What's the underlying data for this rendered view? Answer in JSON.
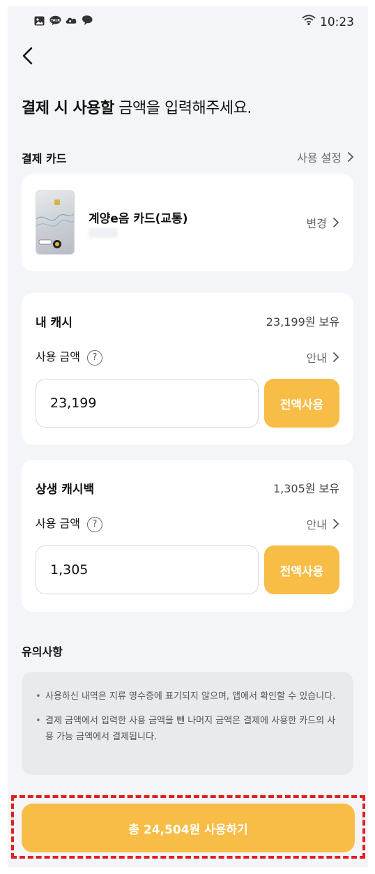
{
  "status_bar": {
    "time": "10:23",
    "icons": [
      "gallery-icon",
      "kakaotalk-icon",
      "cloud-app-icon",
      "chat-icon"
    ],
    "talk_label": "TALK"
  },
  "header": {
    "title_bold": "결제 시 사용할",
    "title_rest": " 금액을 입력해주세요."
  },
  "payment_card": {
    "section_label": "결제 카드",
    "settings_link": "사용 설정",
    "card_name": "계양e음 카드(교통)",
    "change_label": "변경"
  },
  "my_cash": {
    "title": "내 캐시",
    "balance": "23,199원 보유",
    "amount_label": "사용 금액",
    "help": "?",
    "info_link": "안내",
    "amount_value": "23,199",
    "use_all_button": "전액사용"
  },
  "cashback": {
    "title": "상생 캐시백",
    "balance": "1,305원 보유",
    "amount_label": "사용 금액",
    "help": "?",
    "info_link": "안내",
    "amount_value": "1,305",
    "use_all_button": "전액사용"
  },
  "notes": {
    "title": "유의사항",
    "items": [
      "사용하신 내역은 지류 영수증에 표기되지 않으며, 앱에서 확인할 수 있습니다.",
      "결제 금액에서 입력한 사용 금액을 뺀 나머지 금액은 결제에 사용한 카드의 사용 가능 금액에서 결제됩니다."
    ]
  },
  "cta": {
    "label": "총 24,504원 사용하기"
  },
  "colors": {
    "accent": "#f7bd46",
    "background": "#f4f5f8",
    "card": "#ffffff",
    "highlight_outline": "#e02020"
  }
}
